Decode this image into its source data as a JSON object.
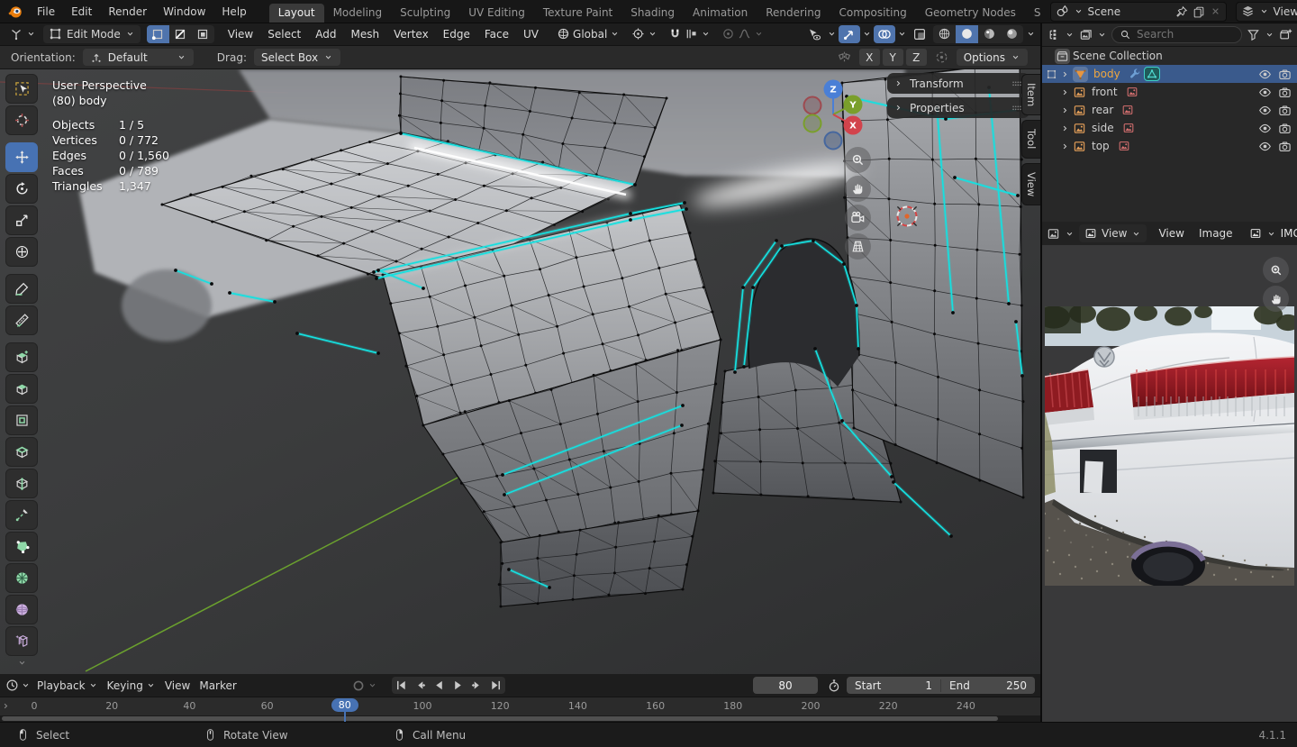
{
  "app": {
    "version": "4.1.1"
  },
  "topbar": {
    "menus": [
      "File",
      "Edit",
      "Render",
      "Window",
      "Help"
    ],
    "workspaces": [
      "Layout",
      "Modeling",
      "Sculpting",
      "UV Editing",
      "Texture Paint",
      "Shading",
      "Animation",
      "Rendering",
      "Compositing",
      "Geometry Nodes",
      "S"
    ],
    "active_workspace": "Layout",
    "scene_name": "Scene",
    "viewlayer_name": "ViewLayer",
    "scene_icons": [
      "scene",
      "pin",
      "duplicate",
      "close"
    ],
    "viewlayer_icons": [
      "viewlayer",
      "duplicate",
      "close"
    ]
  },
  "viewport": {
    "header": {
      "mode": "Edit Mode",
      "select_modes": [
        "vertex-mode",
        "edge-mode",
        "face-mode"
      ],
      "active_select_mode": "vertex-mode",
      "menus": [
        "View",
        "Select",
        "Add",
        "Mesh",
        "Vertex",
        "Edge",
        "Face",
        "UV"
      ],
      "orientation": "Global",
      "mid_icons": [
        "pivot",
        "magnet",
        "snap-target",
        "proportional",
        "falloff-curve"
      ],
      "right_icons": [
        "show-gizmo",
        "gizmos",
        "overlays",
        "toggle-xray"
      ],
      "shading_icons": [
        "shading-wireframe",
        "shading-solid",
        "shading-material",
        "shading-rendered"
      ],
      "active_shading": "shading-solid"
    },
    "tool_settings": {
      "orientation_label": "Orientation:",
      "orientation_value": "Default",
      "drag_label": "Drag:",
      "drag_value": "Select Box",
      "axes": [
        "X",
        "Y",
        "Z"
      ],
      "options_label": "Options"
    },
    "overlay": {
      "perspective": "User Perspective",
      "object": "(80) body",
      "stats": [
        {
          "label": "Objects",
          "value": "1 / 5"
        },
        {
          "label": "Vertices",
          "value": "0 / 772"
        },
        {
          "label": "Edges",
          "value": "0 / 1,560"
        },
        {
          "label": "Faces",
          "value": "0 / 789"
        },
        {
          "label": "Triangles",
          "value": "1,347"
        }
      ]
    },
    "npanel": {
      "panels": [
        "Transform",
        "Properties"
      ],
      "tabs": [
        "Item",
        "Tool",
        "View"
      ],
      "active_tab": "Item"
    },
    "gizmo_axes": [
      "Z",
      "Y",
      "X"
    ],
    "nav_icons": [
      "nav-zoom",
      "nav-hand",
      "nav-camera",
      "nav-grid"
    ],
    "toolbar_tools": [
      "tweak-select",
      "cursor",
      "move",
      "rotate",
      "scale",
      "transform",
      "annotate",
      "measure",
      "add-cube",
      "extrude-region",
      "inset-faces",
      "bevel",
      "loop-cut",
      "knife",
      "poly-build",
      "spin",
      "smooth",
      "rip-region"
    ],
    "active_tool": "move"
  },
  "outliner": {
    "search_placeholder": "Search",
    "root_collection": "Scene Collection",
    "items": [
      {
        "name": "body",
        "type": "mesh",
        "selected": true
      },
      {
        "name": "front",
        "type": "image",
        "selected": false
      },
      {
        "name": "rear",
        "type": "image",
        "selected": false
      },
      {
        "name": "side",
        "type": "image",
        "selected": false
      },
      {
        "name": "top",
        "type": "image",
        "selected": false
      }
    ]
  },
  "image_editor": {
    "mode": "View",
    "menus": [
      "View",
      "Image"
    ],
    "datablock": "IMG"
  },
  "timeline": {
    "menus": [
      "Playback",
      "Keying",
      "View",
      "Marker"
    ],
    "playback_icons": [
      "jump-to-start",
      "previous-keyframe",
      "play-reverse",
      "play",
      "next-keyframe",
      "jump-to-end"
    ],
    "current_frame": "80",
    "current_frame_num": 80,
    "start_label": "Start",
    "start_value": "1",
    "end_label": "End",
    "end_value": "250",
    "ticks": [
      0,
      20,
      40,
      60,
      80,
      100,
      120,
      140,
      160,
      180,
      200,
      220,
      240
    ]
  },
  "statusbar": {
    "hints": [
      {
        "button": "mouse-left",
        "label": "Select"
      },
      {
        "button": "mouse-middle",
        "label": "Rotate View"
      },
      {
        "button": "mouse-right",
        "label": "Call Menu"
      }
    ],
    "version": "4.1.1"
  },
  "colors": {
    "accent": "#4772b3",
    "selected_object_text": "#f0a73f",
    "seam": "#15e0e0",
    "axis_green": "#6ba12e",
    "axis_red": "#a04040"
  }
}
